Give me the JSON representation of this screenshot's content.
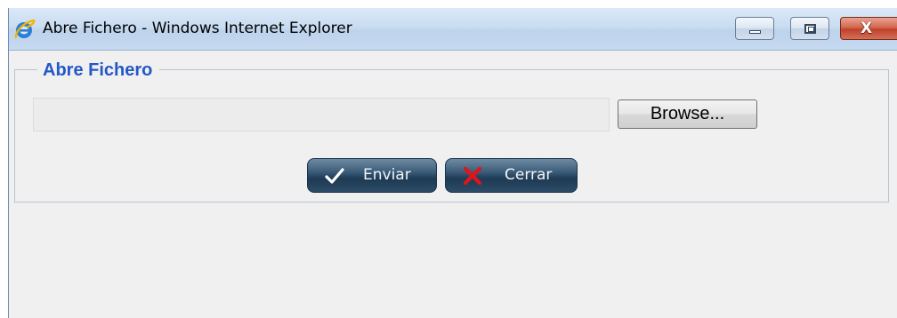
{
  "window": {
    "title": "Abre Fichero - Windows Internet Explorer",
    "icon": "internet-explorer-icon",
    "controls": {
      "minimize": "minimize-icon",
      "maximize": "maximize-icon",
      "close": "close-icon",
      "close_glyph": "X"
    }
  },
  "form": {
    "legend": "Abre Fichero",
    "file_input": {
      "value": "",
      "placeholder": ""
    },
    "browse_label": "Browse...",
    "enviar_label": "Enviar",
    "cerrar_label": "Cerrar"
  },
  "colors": {
    "legend": "#2457c8",
    "close_button": "#c0412a",
    "action_button": "#2d4c67"
  }
}
